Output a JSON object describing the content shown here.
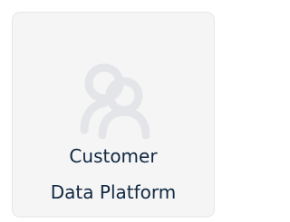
{
  "tile": {
    "label_line1": "Customer",
    "label_line2": "Data Platform",
    "icon": "users-icon"
  },
  "colors": {
    "card_background": "#f5f5f6",
    "card_border": "#e6e7ea",
    "icon": "#e4e5e8",
    "text": "#0f2740"
  }
}
